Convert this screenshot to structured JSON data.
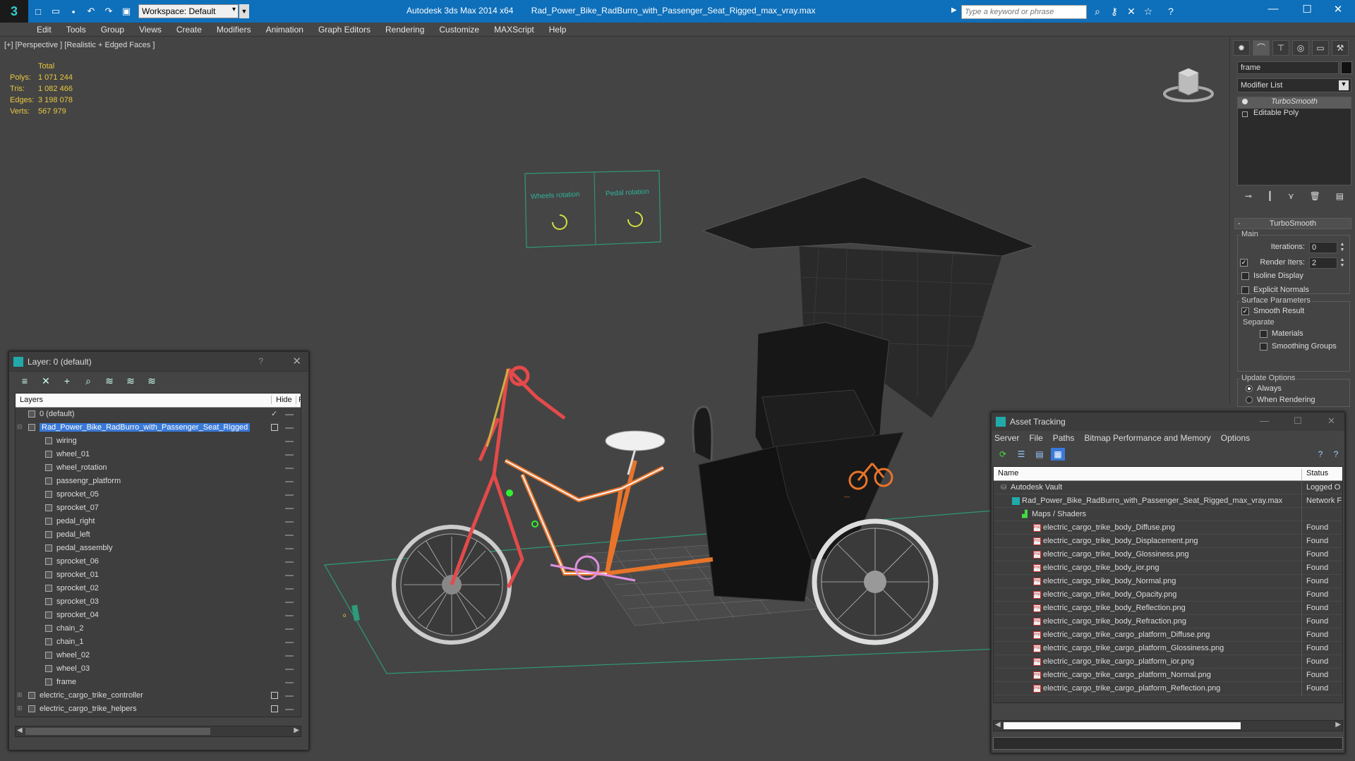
{
  "titlebar": {
    "workspace": "Workspace: Default",
    "app_name": "Autodesk 3ds Max  2014 x64",
    "file_name": "Rad_Power_Bike_RadBurro_with_Passenger_Seat_Rigged_max_vray.max",
    "search_placeholder": "Type a keyword or phrase"
  },
  "menu": [
    "Edit",
    "Tools",
    "Group",
    "Views",
    "Create",
    "Modifiers",
    "Animation",
    "Graph Editors",
    "Rendering",
    "Customize",
    "MAXScript",
    "Help"
  ],
  "viewport": {
    "label": "[+] [Perspective ] [Realistic + Edged Faces ]",
    "stats": {
      "header": "Total",
      "rows": [
        {
          "label": "Polys:",
          "value": "1 071 244"
        },
        {
          "label": "Tris:",
          "value": "1 082 466"
        },
        {
          "label": "Edges:",
          "value": "3 198 078"
        },
        {
          "label": "Verts:",
          "value": "567 979"
        }
      ]
    },
    "control_labels": {
      "wheels": "Wheels rotation",
      "pedal": "Pedal rotation"
    }
  },
  "command_panel": {
    "object_name": "frame",
    "modifier_list": "Modifier List",
    "stack": [
      "TurboSmooth",
      "Editable Poly"
    ],
    "rollout_title": "TurboSmooth",
    "main_group": "Main",
    "iterations_label": "Iterations:",
    "iterations_value": "0",
    "render_iters_label": "Render Iters:",
    "render_iters_value": "2",
    "isoline_label": "Isoline Display",
    "explicit_normals_label": "Explicit Normals",
    "surface_group": "Surface Parameters",
    "smooth_result_label": "Smooth Result",
    "separate_label": "Separate",
    "materials_label": "Materials",
    "smoothing_groups_label": "Smoothing Groups",
    "update_group": "Update Options",
    "always_label": "Always",
    "when_rendering_label": "When Rendering"
  },
  "layer_dialog": {
    "title": "Layer: 0 (default)",
    "help": "?",
    "col_layers": "Layers",
    "col_hide": "Hide",
    "col_f": "F",
    "rows": [
      {
        "name": "0 (default)",
        "level": 0,
        "hide": "check",
        "expand": ""
      },
      {
        "name": "Rad_Power_Bike_RadBurro_with_Passenger_Seat_Rigged",
        "level": 0,
        "hide": "box",
        "expand": "⊟",
        "selected": true
      },
      {
        "name": "wiring",
        "level": 1,
        "hide": ""
      },
      {
        "name": "wheel_01",
        "level": 1,
        "hide": ""
      },
      {
        "name": "wheel_rotation",
        "level": 1,
        "hide": ""
      },
      {
        "name": "passengr_platform",
        "level": 1,
        "hide": ""
      },
      {
        "name": "sprocket_05",
        "level": 1,
        "hide": ""
      },
      {
        "name": "sprocket_07",
        "level": 1,
        "hide": ""
      },
      {
        "name": "pedal_right",
        "level": 1,
        "hide": ""
      },
      {
        "name": "pedal_left",
        "level": 1,
        "hide": ""
      },
      {
        "name": "pedal_assembly",
        "level": 1,
        "hide": ""
      },
      {
        "name": "sprocket_06",
        "level": 1,
        "hide": ""
      },
      {
        "name": "sprocket_01",
        "level": 1,
        "hide": ""
      },
      {
        "name": "sprocket_02",
        "level": 1,
        "hide": ""
      },
      {
        "name": "sprocket_03",
        "level": 1,
        "hide": ""
      },
      {
        "name": "sprocket_04",
        "level": 1,
        "hide": ""
      },
      {
        "name": "chain_2",
        "level": 1,
        "hide": ""
      },
      {
        "name": "chain_1",
        "level": 1,
        "hide": ""
      },
      {
        "name": "wheel_02",
        "level": 1,
        "hide": ""
      },
      {
        "name": "wheel_03",
        "level": 1,
        "hide": ""
      },
      {
        "name": "frame",
        "level": 1,
        "hide": ""
      },
      {
        "name": "electric_cargo_trike_controller",
        "level": 0,
        "hide": "box",
        "expand": "⊞"
      },
      {
        "name": "electric_cargo_trike_helpers",
        "level": 0,
        "hide": "box",
        "expand": "⊞"
      }
    ]
  },
  "asset_dialog": {
    "title": "Asset Tracking",
    "menu": [
      "Server",
      "File",
      "Paths",
      "Bitmap Performance and Memory",
      "Options"
    ],
    "col_name": "Name",
    "col_status": "Status",
    "rows": [
      {
        "name": "Autodesk Vault",
        "status": "Logged O",
        "level": 0,
        "icon": "vault"
      },
      {
        "name": "Rad_Power_Bike_RadBurro_with_Passenger_Seat_Rigged_max_vray.max",
        "status": "Network F",
        "level": 1,
        "icon": "max"
      },
      {
        "name": "Maps / Shaders",
        "status": "",
        "level": 2,
        "icon": "maps"
      },
      {
        "name": "electric_cargo_trike_body_Diffuse.png",
        "status": "Found",
        "level": 3,
        "icon": "png"
      },
      {
        "name": "electric_cargo_trike_body_Displacement.png",
        "status": "Found",
        "level": 3,
        "icon": "png"
      },
      {
        "name": "electric_cargo_trike_body_Glossiness.png",
        "status": "Found",
        "level": 3,
        "icon": "png"
      },
      {
        "name": "electric_cargo_trike_body_ior.png",
        "status": "Found",
        "level": 3,
        "icon": "png"
      },
      {
        "name": "electric_cargo_trike_body_Normal.png",
        "status": "Found",
        "level": 3,
        "icon": "png"
      },
      {
        "name": "electric_cargo_trike_body_Opacity.png",
        "status": "Found",
        "level": 3,
        "icon": "png"
      },
      {
        "name": "electric_cargo_trike_body_Reflection.png",
        "status": "Found",
        "level": 3,
        "icon": "png"
      },
      {
        "name": "electric_cargo_trike_body_Refraction.png",
        "status": "Found",
        "level": 3,
        "icon": "png"
      },
      {
        "name": "electric_cargo_trike_cargo_platform_Diffuse.png",
        "status": "Found",
        "level": 3,
        "icon": "png"
      },
      {
        "name": "electric_cargo_trike_cargo_platform_Glossiness.png",
        "status": "Found",
        "level": 3,
        "icon": "png"
      },
      {
        "name": "electric_cargo_trike_cargo_platform_ior.png",
        "status": "Found",
        "level": 3,
        "icon": "png"
      },
      {
        "name": "electric_cargo_trike_cargo_platform_Normal.png",
        "status": "Found",
        "level": 3,
        "icon": "png"
      },
      {
        "name": "electric_cargo_trike_cargo_platform_Reflection.png",
        "status": "Found",
        "level": 3,
        "icon": "png"
      }
    ]
  },
  "colors": {
    "titlebar": "#0e6fba",
    "selection": "#3979d8",
    "stats_text": "#e8c840",
    "frame_orange": "#e8742a",
    "front_red": "#e44a4a"
  }
}
